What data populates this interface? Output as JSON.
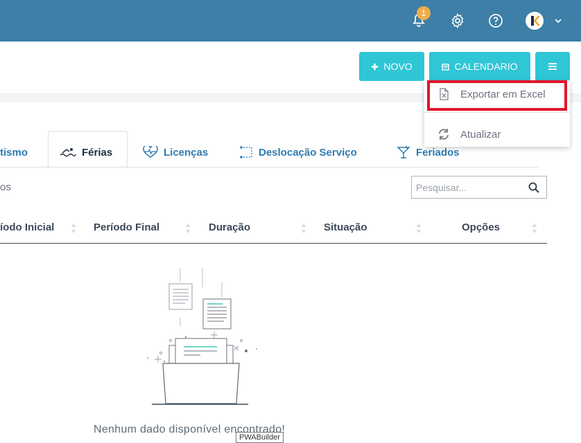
{
  "topbar": {
    "notification_count": "1",
    "icons": [
      "bell-icon",
      "gear-icon",
      "help-icon",
      "avatar",
      "chevron-down-icon"
    ]
  },
  "toolbar": {
    "novo_label": "NOVO",
    "calendario_label": "CALENDARIO"
  },
  "menu": {
    "items": [
      {
        "label": "Exportar em Excel",
        "icon": "excel-file-icon"
      },
      {
        "label": "Atualizar",
        "icon": "refresh-icon"
      }
    ]
  },
  "tabs": [
    {
      "label": "tismo"
    },
    {
      "label": "Férias",
      "icon": "swimmer-icon",
      "active": true
    },
    {
      "label": "Licenças",
      "icon": "heartbeat-icon"
    },
    {
      "label": "Deslocação Serviço",
      "icon": "route-icon"
    },
    {
      "label": "Feriados",
      "icon": "cocktail-icon"
    }
  ],
  "list": {
    "left_text": "os",
    "search_placeholder": "Pesquisar...",
    "columns": [
      "íodo Inicial",
      "Período Final",
      "Duração",
      "Situação",
      "Opções"
    ],
    "empty_message": "Nenhum dado disponível encontrado!"
  },
  "overlay": {
    "pwa_label": "PWABuilder"
  },
  "colors": {
    "topbar": "#3d7fa6",
    "accent_button": "#2fc6d6",
    "tab_text": "#2e7bb0",
    "highlight": "#e2142a"
  }
}
